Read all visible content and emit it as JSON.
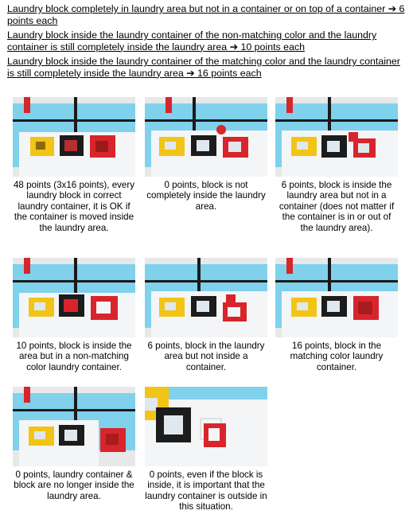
{
  "rules": [
    "Laundry block completely in laundry area but not in a container or on top of a container ➔ 6 points each",
    "Laundry block inside the laundry container of the non-matching color and the laundry container is still completely inside the laundry area ➔ 10 points each",
    "Laundry block inside the laundry container of the matching color and the laundry container is still completely inside the laundry area ➔ 16 points each"
  ],
  "captions": [
    "48 points (3x16 points), every laundry block in correct laundry container, it is OK if the container is moved inside the laundry area.",
    "0 points, block is not completely inside the laundry area.",
    "6 points, block is inside the laundry area but not in a container (does not matter if the container is in or out of the laundry area).",
    "10 points, block is inside the area but in a non-matching color laundry container.",
    "6 points, block in the laundry area but not inside a container.",
    "16 points, block in the matching color laundry container.",
    "0 points, laundry container & block are no longer inside the laundry area.",
    "0 points, even if the block is inside, it is important that the laundry container is outside in this situation."
  ],
  "colors": {
    "mat_blue": "#7fd1ec",
    "mat_white": "#f4f5f6",
    "line_black": "#1a1a1a",
    "yellow": "#f2c416",
    "black_container": "#1c1c1c",
    "red": "#d8252b"
  }
}
